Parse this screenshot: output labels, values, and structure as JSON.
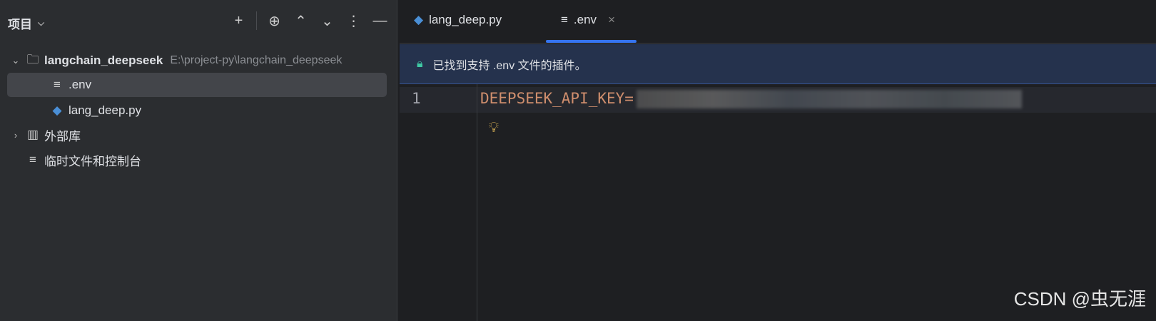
{
  "sidebar": {
    "title": "项目",
    "tree": [
      {
        "label": "langchain_deepseek",
        "path": "E:\\project-py\\langchain_deepseek"
      },
      {
        "label": ".env"
      },
      {
        "label": "lang_deep.py"
      },
      {
        "label": "外部库"
      },
      {
        "label": "临时文件和控制台"
      }
    ]
  },
  "tabs": [
    {
      "label": "lang_deep.py"
    },
    {
      "label": ".env"
    }
  ],
  "banner": {
    "text": "已找到支持 .env 文件的插件。"
  },
  "editor": {
    "line_number": "1",
    "key": "DEEPSEEK_API_KEY="
  },
  "watermark": "CSDN @虫无涯"
}
